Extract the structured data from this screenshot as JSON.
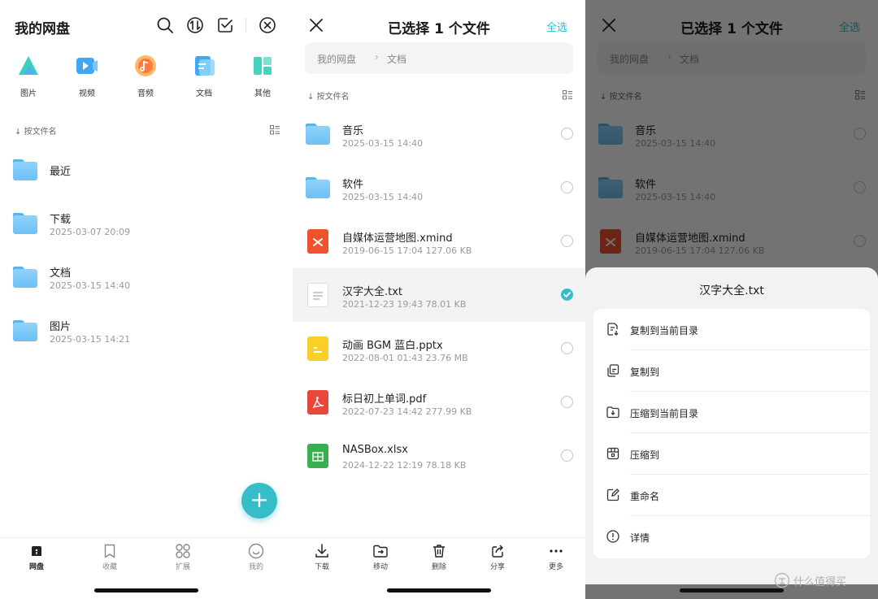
{
  "panel1": {
    "title": "我的网盘",
    "categories": [
      {
        "label": "图片",
        "icon": "image-icon"
      },
      {
        "label": "视频",
        "icon": "video-icon"
      },
      {
        "label": "音频",
        "icon": "audio-icon"
      },
      {
        "label": "文档",
        "icon": "document-icon"
      },
      {
        "label": "其他",
        "icon": "other-icon"
      }
    ],
    "sort_label": "按文件名",
    "folders": [
      {
        "name": "最近",
        "date": ""
      },
      {
        "name": "下载",
        "date": "2025-03-07 20:09"
      },
      {
        "name": "文档",
        "date": "2025-03-15 14:40"
      },
      {
        "name": "图片",
        "date": "2025-03-15 14:21"
      }
    ],
    "fab_label": "+",
    "tabs": [
      {
        "label": "网盘",
        "icon": "home-icon"
      },
      {
        "label": "收藏",
        "icon": "bookmark-icon"
      },
      {
        "label": "扩展",
        "icon": "grid-icon"
      },
      {
        "label": "我的",
        "icon": "smile-icon"
      }
    ]
  },
  "panel2": {
    "title": "已选择 1 个文件",
    "select_all": "全选",
    "breadcrumb": [
      "我的网盘",
      "文档"
    ],
    "breadcrumb_sep": "›",
    "sort_label": "按文件名",
    "files": [
      {
        "name": "音乐",
        "meta": "2025-03-15 14:40",
        "type": "folder",
        "selected": false
      },
      {
        "name": "软件",
        "meta": "2025-03-15 14:40",
        "type": "folder",
        "selected": false
      },
      {
        "name": "自媒体运营地图.xmind",
        "meta": "2019-06-15 17:04   127.06 KB",
        "type": "xmind",
        "selected": false
      },
      {
        "name": "汉字大全.txt",
        "meta": "2021-12-23 19:43   78.01 KB",
        "type": "txt",
        "selected": true
      },
      {
        "name": "动画 BGM 蓝白.pptx",
        "meta": "2022-08-01 01:43   23.76 MB",
        "type": "pptx",
        "selected": false
      },
      {
        "name": "标日初上单词.pdf",
        "meta": "2022-07-23 14:42   277.99 KB",
        "type": "pdf",
        "selected": false
      },
      {
        "name": "NASBox.xlsx",
        "meta": "2024-12-22 12:19   78.18 KB",
        "type": "xlsx",
        "selected": false
      }
    ],
    "actions": [
      {
        "label": "下载",
        "icon": "download-icon"
      },
      {
        "label": "移动",
        "icon": "move-icon"
      },
      {
        "label": "删除",
        "icon": "trash-icon"
      },
      {
        "label": "分享",
        "icon": "share-icon"
      },
      {
        "label": "更多",
        "icon": "more-icon"
      }
    ]
  },
  "panel3": {
    "sheet_title": "汉字大全.txt",
    "menu": [
      {
        "label": "复制到当前目录",
        "icon": "copy-here-icon"
      },
      {
        "label": "复制到",
        "icon": "copy-to-icon"
      },
      {
        "label": "压缩到当前目录",
        "icon": "compress-here-icon"
      },
      {
        "label": "压缩到",
        "icon": "compress-to-icon"
      },
      {
        "label": "重命名",
        "icon": "rename-icon"
      },
      {
        "label": "详情",
        "icon": "info-icon"
      }
    ]
  },
  "watermark": "什么值得买",
  "colors": {
    "accent": "#36bdc8",
    "folder": "#6cc0f4",
    "overlay": "rgba(0,0,0,0.55)"
  }
}
